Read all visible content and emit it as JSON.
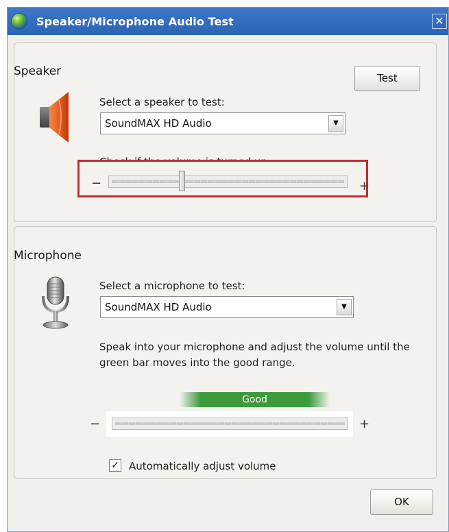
{
  "window": {
    "title": "Speaker/Microphone Audio Test",
    "close_glyph": "✕"
  },
  "speaker": {
    "group_title": "Speaker",
    "select_label": "Select a speaker to test:",
    "selected_device": "SoundMAX HD Audio",
    "test_button": "Test",
    "volume_label": "Check if the volume is turned up:",
    "volume_level_fraction": 0.3,
    "minus": "−",
    "plus": "+",
    "icon": "speaker-icon"
  },
  "microphone": {
    "group_title": "Microphone",
    "select_label": "Select a microphone to test:",
    "selected_device": "SoundMAX HD Audio",
    "instructions": "Speak into your microphone and adjust the volume until the green bar moves into the good range.",
    "good_label": "Good",
    "minus": "−",
    "plus": "+",
    "auto_adjust_label": "Automatically adjust volume",
    "auto_adjust_checked": true,
    "icon": "microphone-icon"
  },
  "footer": {
    "ok_button": "OK"
  },
  "colors": {
    "titlebar": "#2b64b4",
    "highlight_border": "#c42a31",
    "good_bar": "#3c9a3a",
    "speaker_cone": "#e85a1c"
  }
}
